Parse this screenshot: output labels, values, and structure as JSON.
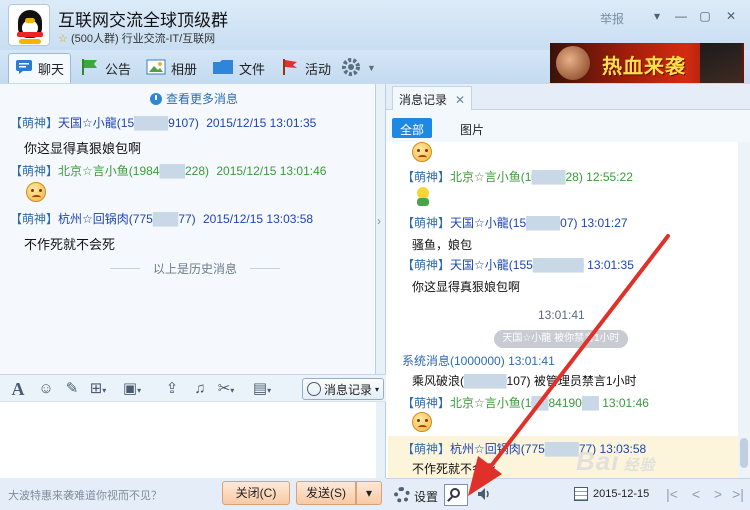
{
  "window": {
    "title": "互联网交流全球顶级群",
    "subtitle": "(500人群) 行业交流-IT/互联网",
    "report_label": "举报",
    "star": "☆"
  },
  "tabs": [
    {
      "label": "聊天",
      "icon": "chat-icon"
    },
    {
      "label": "公告",
      "icon": "announcement-icon"
    },
    {
      "label": "相册",
      "icon": "album-icon"
    },
    {
      "label": "文件",
      "icon": "folder-icon"
    },
    {
      "label": "活动",
      "icon": "flag-icon"
    }
  ],
  "banner": {
    "text": "热血来袭"
  },
  "chat": {
    "more_label": "查看更多消息",
    "messages": [
      {
        "badge": "【萌神】",
        "nick": "天国☆小龍(15",
        "nick_tail": "9107)",
        "time": "2015/12/15 13:01:35",
        "text": "你这显得真狠娘包啊",
        "color": "blue"
      },
      {
        "badge": "【萌神】",
        "nick": "北京☆言小鱼(1984",
        "nick_tail": "228)",
        "time": "2015/12/15 13:01:46",
        "text": "",
        "color": "green"
      },
      {
        "badge": "【萌神】",
        "nick": "杭州☆回锅肉(775",
        "nick_tail": "77)",
        "time": "2015/12/15 13:03:58",
        "text": "不作死就不会死",
        "color": "blue"
      }
    ],
    "history_label": "以上是历史消息"
  },
  "toolbar": {
    "history_button": "消息记录"
  },
  "footer": {
    "ad_text": "大波特惠来袭难道你视而不见？",
    "close_label": "关闭(C)",
    "send_label": "发送(S)"
  },
  "history_panel": {
    "tab_label": "消息记录",
    "filters": [
      "全部",
      "图片"
    ],
    "entries": [
      {
        "badge": "【萌神】",
        "nick": "北京☆言小鱼(1",
        "nick_tail": "28)",
        "time": "12:55:22",
        "color": "green"
      },
      {
        "badge": "【萌神】",
        "nick": "天国☆小龍(15",
        "nick_tail": "07)",
        "time": "13:01:27",
        "color": "blue",
        "text": "骚鱼，娘包"
      },
      {
        "badge": "【萌神】",
        "nick": "天国☆小龍(155",
        "nick_tail": "",
        "time": "13:01:35",
        "color": "blue",
        "text": "你这显得真狠娘包啊"
      }
    ],
    "separator_time": "13:01:41",
    "system_note": "天国☆小龍 被你禁言1小时",
    "system_line": {
      "name": "系统消息(1000000)",
      "time": "13:01:41",
      "text_a": "乘风破浪(",
      "text_b": "107) 被管理员禁言1小时"
    },
    "entry_after": {
      "badge": "【萌神】",
      "nick": "北京☆言小鱼(1",
      "nick_tail": "84190",
      "time": "13:01:46"
    },
    "last": {
      "badge": "【萌神】",
      "nick": "杭州☆回锅肉(775",
      "nick_tail": "77)",
      "time": "13:03:58",
      "text": "不作死就不会死"
    },
    "settings_label": "设置",
    "date": "2015-12-15"
  },
  "watermark": {
    "text": "Bai",
    "suffix": "经验"
  },
  "colors": {
    "accent": "#1e88e5",
    "arrow": "#e0302a",
    "blue_nick": "#1c45b4",
    "green_nick": "#3a9a3a"
  }
}
